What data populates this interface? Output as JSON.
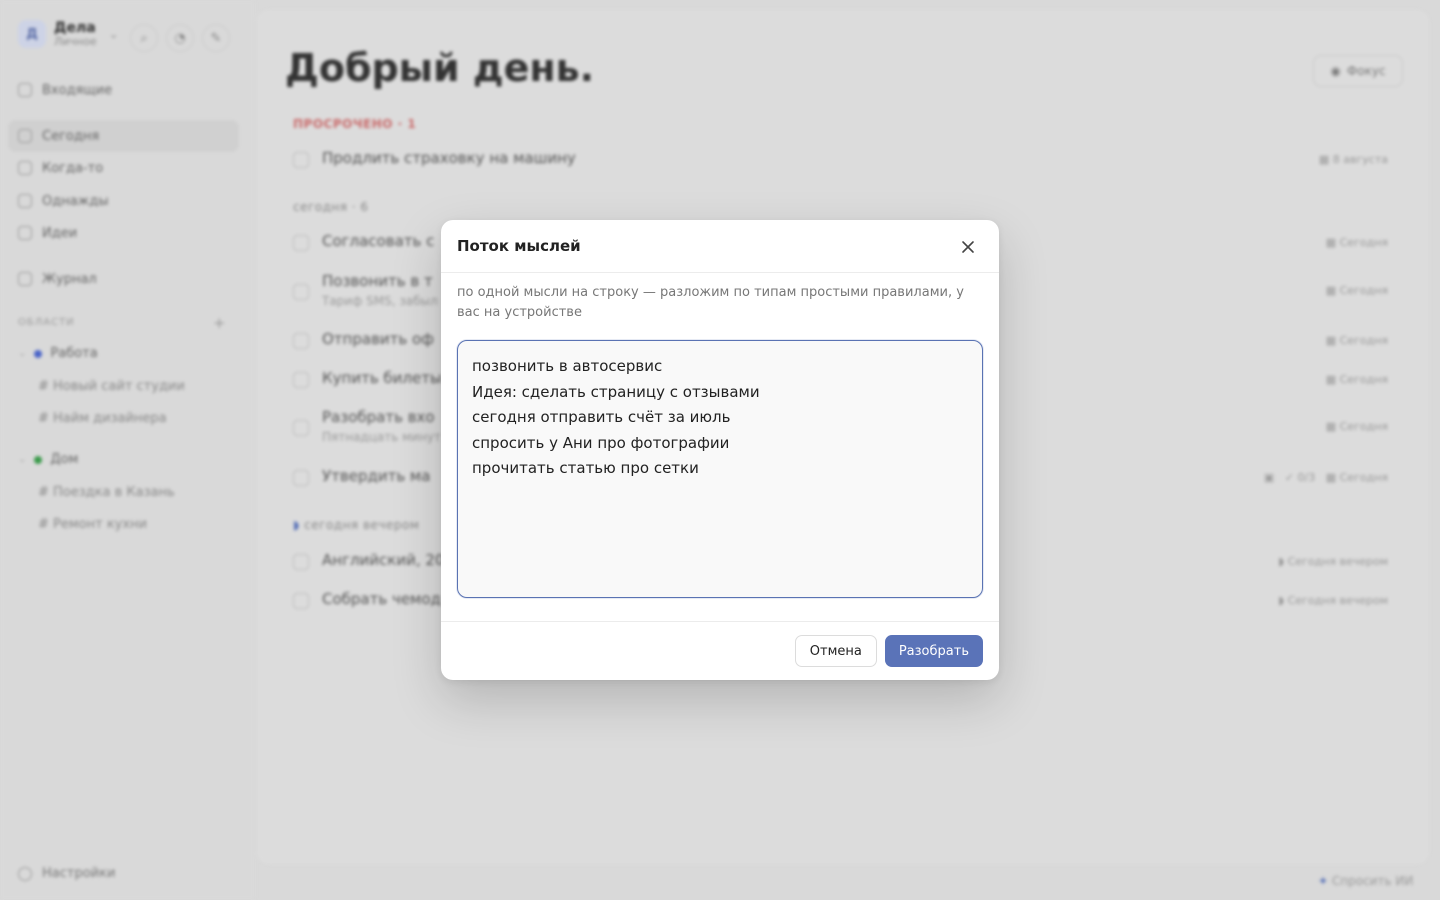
{
  "workspace": {
    "initial": "Д",
    "name": "Дела",
    "subtitle": "Личное"
  },
  "sidebar": {
    "nav": [
      {
        "label": "Входящие"
      },
      {
        "label": "Сегодня"
      },
      {
        "label": "Когда-то"
      },
      {
        "label": "Однажды"
      },
      {
        "label": "Идеи"
      },
      {
        "label": "Журнал"
      }
    ],
    "areas_label": "ОБЛАСТИ",
    "areas": [
      {
        "name": "Работа",
        "color": "#4a64c8",
        "projects": [
          "Новый сайт студии",
          "Найм дизайнера"
        ]
      },
      {
        "name": "Дом",
        "color": "#3a9a4a",
        "projects": [
          "Поездка в Казань",
          "Ремонт кухни"
        ]
      }
    ],
    "settings": "Настройки"
  },
  "main": {
    "greeting": "Добрый день.",
    "focus_label": "Фокус",
    "overdue_label": "ПРОСРОЧЕНО · 1",
    "overdue": [
      {
        "title": "Продлить страховку на машину",
        "due": "8 августа"
      }
    ],
    "today_label": "сегодня · 6",
    "today": [
      {
        "title": "Согласовать с",
        "due": "Сегодня"
      },
      {
        "title": "Позвонить в т",
        "sub": "Тариф SMS, забыл",
        "due": "Сегодня"
      },
      {
        "title": "Отправить оф",
        "due": "Сегодня"
      },
      {
        "title": "Купить билеты",
        "due": "Сегодня"
      },
      {
        "title": "Разобрать вхо",
        "sub": "Пятнадцать минут",
        "due": "Сегодня"
      },
      {
        "title": "Утвердить ма",
        "meta": "0/3",
        "due": "Сегодня"
      }
    ],
    "evening_label": "сегодня вечером",
    "evening": [
      {
        "title": "Английский, 20",
        "due": "Сегодня вечером"
      },
      {
        "title": "Собрать чемод",
        "due": "Сегодня вечером"
      }
    ],
    "ask_ai": "Спросить ИИ"
  },
  "modal": {
    "title": "Поток мыслей",
    "close_icon": "close-icon",
    "hint": "по одной мысли на строку — разложим по типам простыми правилами, у вас на устройстве",
    "text": "позвонить в автосервис\nИдея: сделать страницу с отзывами\nсегодня отправить счёт за июль\nспросить у Ани про фотографии\nпрочитать статью про сетки",
    "cancel_label": "Отмена",
    "submit_label": "Разобрать",
    "accent_color": "#5a73b8"
  }
}
